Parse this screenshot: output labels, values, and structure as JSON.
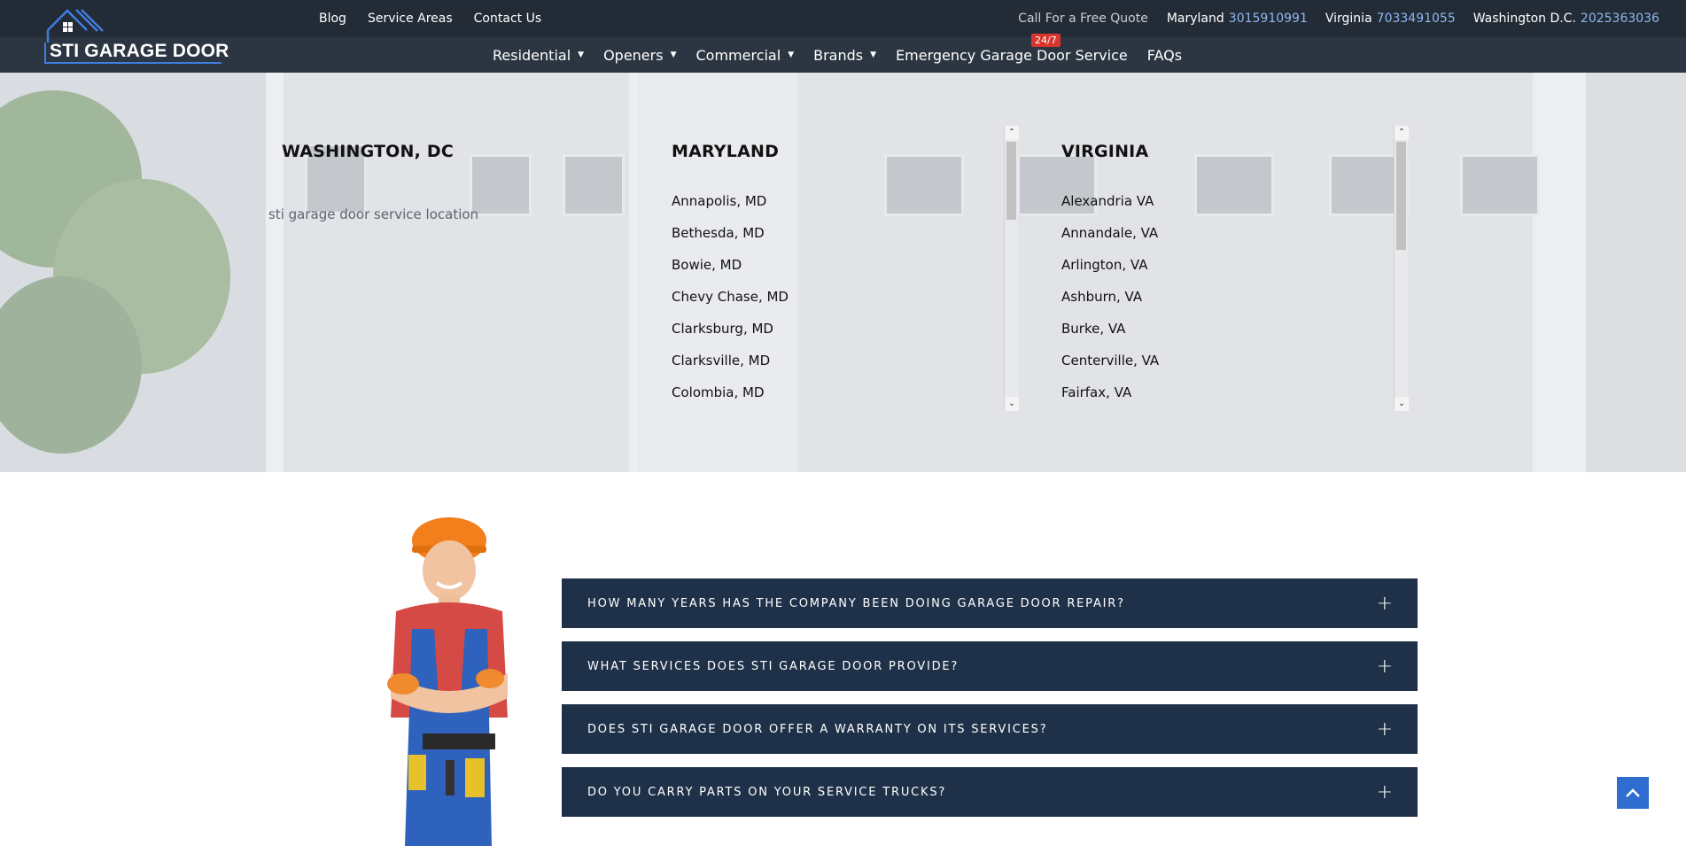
{
  "brand": {
    "name": "STI GARAGE DOOR",
    "accent": "#3f7de0"
  },
  "top_links": [
    "Blog",
    "Service Areas",
    "Contact Us"
  ],
  "quote": {
    "label": "Call For a Free Quote",
    "contacts": [
      {
        "region": "Maryland",
        "phone": "3015910991"
      },
      {
        "region": "Virginia",
        "phone": "7033491055"
      },
      {
        "region": "Washington D.C.",
        "phone": "2025363036"
      }
    ]
  },
  "main_nav": {
    "items": [
      {
        "label": "Residential",
        "dropdown": true
      },
      {
        "label": "Openers",
        "dropdown": true
      },
      {
        "label": "Commercial",
        "dropdown": true
      },
      {
        "label": "Brands",
        "dropdown": true
      },
      {
        "label": "Emergency Garage Door Service",
        "dropdown": false
      },
      {
        "label": "FAQs",
        "dropdown": false
      }
    ],
    "badge": "24/7"
  },
  "locations": {
    "dc": {
      "title": "WASHINGTON, DC",
      "image_alt": "sti garage door service location"
    },
    "maryland": {
      "title": "MARYLAND",
      "items": [
        "Annapolis, MD",
        "Bethesda, MD",
        "Bowie, MD",
        "Chevy Chase, MD",
        "Clarksburg, MD",
        "Clarksville, MD",
        "Colombia, MD"
      ]
    },
    "virginia": {
      "title": "VIRGINIA",
      "items": [
        "Alexandria VA",
        "Annandale, VA",
        "Arlington, VA",
        "Ashburn, VA",
        "Burke, VA",
        "Centerville, VA",
        "Fairfax, VA"
      ]
    }
  },
  "faq": {
    "items": [
      "HOW MANY YEARS HAS THE COMPANY BEEN DOING GARAGE DOOR REPAIR?",
      "WHAT SERVICES DOES STI GARAGE DOOR PROVIDE?",
      "DOES STI GARAGE DOOR OFFER A WARRANTY ON ITS SERVICES?",
      "DO YOU CARRY PARTS ON YOUR SERVICE TRUCKS?"
    ],
    "expand_icon": "plus-icon"
  },
  "colors": {
    "topbar": "#232b36",
    "navbar": "#2c3643",
    "faq_bg": "#1f3149",
    "phone": "#8fb8f0",
    "badge": "#d9352c",
    "back_to_top": "#2f6dd0"
  }
}
